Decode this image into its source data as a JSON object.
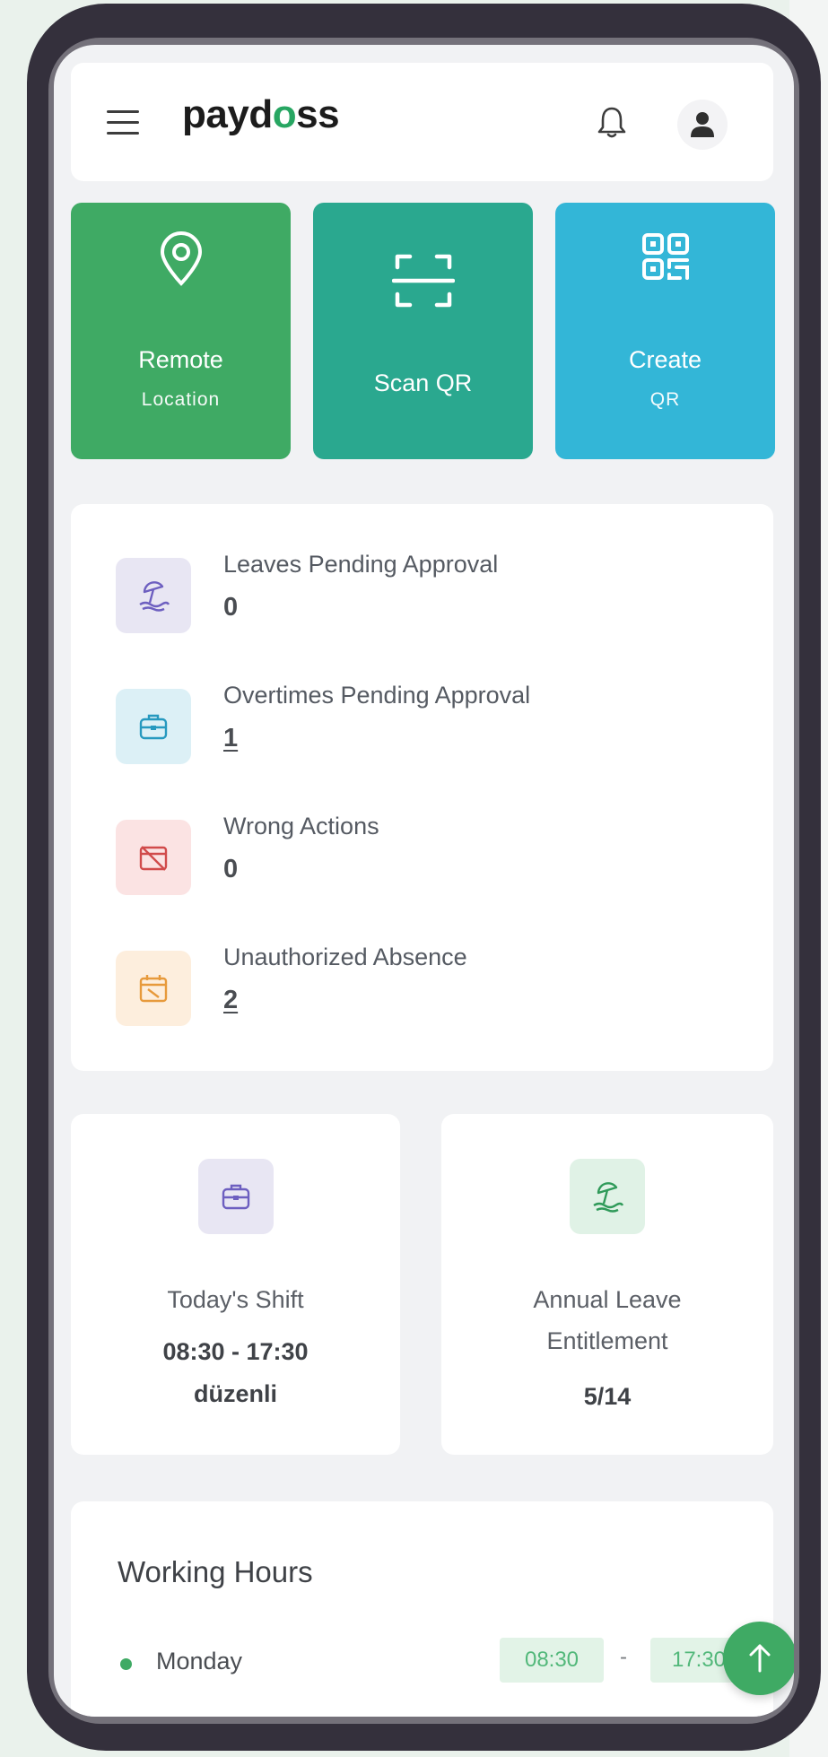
{
  "header": {
    "logo_part1": "payd",
    "logo_o": "o",
    "logo_part2": "ss"
  },
  "actions": {
    "remote_location": {
      "line1": "Remote",
      "line2": "Location",
      "icon": "map-pin-icon",
      "color": "#3faa64"
    },
    "scan_qr": {
      "line1": "Scan QR",
      "icon": "scan-icon",
      "color": "#2aa88f"
    },
    "create_qr": {
      "line1": "Create",
      "line2": "QR",
      "icon": "qr-code-icon",
      "color": "#33b6d7"
    }
  },
  "summary": {
    "leaves_pending": {
      "label": "Leaves Pending Approval",
      "value": "0",
      "icon": "beach-umbrella-icon"
    },
    "overtimes_pending": {
      "label": "Overtimes Pending Approval",
      "value": "1",
      "icon": "briefcase-icon"
    },
    "wrong_actions": {
      "label": "Wrong Actions",
      "value": "0",
      "icon": "calendar-cross-icon"
    },
    "unauthorized_absence": {
      "label": "Unauthorized Absence",
      "value": "2",
      "icon": "calendar-icon"
    }
  },
  "shift": {
    "label": "Today's Shift",
    "time": "08:30 - 17:30",
    "type": "düzenli"
  },
  "annual_leave": {
    "label_line1": "Annual Leave",
    "label_line2": "Entitlement",
    "value": "5/14"
  },
  "working_hours": {
    "title": "Working Hours",
    "rows": [
      {
        "day": "Monday",
        "start": "08:30",
        "separator": "-",
        "end": "17:30"
      }
    ]
  }
}
